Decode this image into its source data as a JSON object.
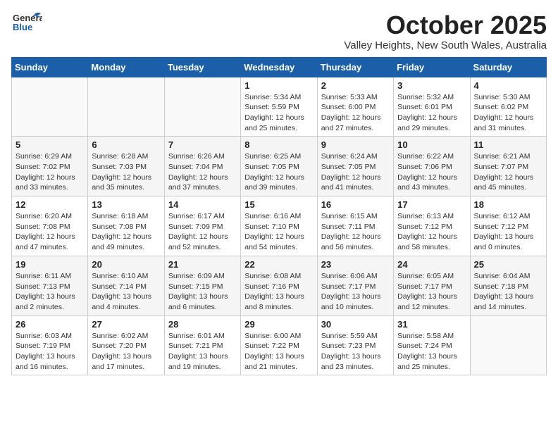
{
  "header": {
    "logo_general": "General",
    "logo_blue": "Blue",
    "title": "October 2025",
    "subtitle": "Valley Heights, New South Wales, Australia"
  },
  "days_of_week": [
    "Sunday",
    "Monday",
    "Tuesday",
    "Wednesday",
    "Thursday",
    "Friday",
    "Saturday"
  ],
  "weeks": [
    [
      {
        "day": "",
        "info": ""
      },
      {
        "day": "",
        "info": ""
      },
      {
        "day": "",
        "info": ""
      },
      {
        "day": "1",
        "info": "Sunrise: 5:34 AM\nSunset: 5:59 PM\nDaylight: 12 hours\nand 25 minutes."
      },
      {
        "day": "2",
        "info": "Sunrise: 5:33 AM\nSunset: 6:00 PM\nDaylight: 12 hours\nand 27 minutes."
      },
      {
        "day": "3",
        "info": "Sunrise: 5:32 AM\nSunset: 6:01 PM\nDaylight: 12 hours\nand 29 minutes."
      },
      {
        "day": "4",
        "info": "Sunrise: 5:30 AM\nSunset: 6:02 PM\nDaylight: 12 hours\nand 31 minutes."
      }
    ],
    [
      {
        "day": "5",
        "info": "Sunrise: 6:29 AM\nSunset: 7:02 PM\nDaylight: 12 hours\nand 33 minutes."
      },
      {
        "day": "6",
        "info": "Sunrise: 6:28 AM\nSunset: 7:03 PM\nDaylight: 12 hours\nand 35 minutes."
      },
      {
        "day": "7",
        "info": "Sunrise: 6:26 AM\nSunset: 7:04 PM\nDaylight: 12 hours\nand 37 minutes."
      },
      {
        "day": "8",
        "info": "Sunrise: 6:25 AM\nSunset: 7:05 PM\nDaylight: 12 hours\nand 39 minutes."
      },
      {
        "day": "9",
        "info": "Sunrise: 6:24 AM\nSunset: 7:05 PM\nDaylight: 12 hours\nand 41 minutes."
      },
      {
        "day": "10",
        "info": "Sunrise: 6:22 AM\nSunset: 7:06 PM\nDaylight: 12 hours\nand 43 minutes."
      },
      {
        "day": "11",
        "info": "Sunrise: 6:21 AM\nSunset: 7:07 PM\nDaylight: 12 hours\nand 45 minutes."
      }
    ],
    [
      {
        "day": "12",
        "info": "Sunrise: 6:20 AM\nSunset: 7:08 PM\nDaylight: 12 hours\nand 47 minutes."
      },
      {
        "day": "13",
        "info": "Sunrise: 6:18 AM\nSunset: 7:08 PM\nDaylight: 12 hours\nand 49 minutes."
      },
      {
        "day": "14",
        "info": "Sunrise: 6:17 AM\nSunset: 7:09 PM\nDaylight: 12 hours\nand 52 minutes."
      },
      {
        "day": "15",
        "info": "Sunrise: 6:16 AM\nSunset: 7:10 PM\nDaylight: 12 hours\nand 54 minutes."
      },
      {
        "day": "16",
        "info": "Sunrise: 6:15 AM\nSunset: 7:11 PM\nDaylight: 12 hours\nand 56 minutes."
      },
      {
        "day": "17",
        "info": "Sunrise: 6:13 AM\nSunset: 7:12 PM\nDaylight: 12 hours\nand 58 minutes."
      },
      {
        "day": "18",
        "info": "Sunrise: 6:12 AM\nSunset: 7:12 PM\nDaylight: 13 hours\nand 0 minutes."
      }
    ],
    [
      {
        "day": "19",
        "info": "Sunrise: 6:11 AM\nSunset: 7:13 PM\nDaylight: 13 hours\nand 2 minutes."
      },
      {
        "day": "20",
        "info": "Sunrise: 6:10 AM\nSunset: 7:14 PM\nDaylight: 13 hours\nand 4 minutes."
      },
      {
        "day": "21",
        "info": "Sunrise: 6:09 AM\nSunset: 7:15 PM\nDaylight: 13 hours\nand 6 minutes."
      },
      {
        "day": "22",
        "info": "Sunrise: 6:08 AM\nSunset: 7:16 PM\nDaylight: 13 hours\nand 8 minutes."
      },
      {
        "day": "23",
        "info": "Sunrise: 6:06 AM\nSunset: 7:17 PM\nDaylight: 13 hours\nand 10 minutes."
      },
      {
        "day": "24",
        "info": "Sunrise: 6:05 AM\nSunset: 7:17 PM\nDaylight: 13 hours\nand 12 minutes."
      },
      {
        "day": "25",
        "info": "Sunrise: 6:04 AM\nSunset: 7:18 PM\nDaylight: 13 hours\nand 14 minutes."
      }
    ],
    [
      {
        "day": "26",
        "info": "Sunrise: 6:03 AM\nSunset: 7:19 PM\nDaylight: 13 hours\nand 16 minutes."
      },
      {
        "day": "27",
        "info": "Sunrise: 6:02 AM\nSunset: 7:20 PM\nDaylight: 13 hours\nand 17 minutes."
      },
      {
        "day": "28",
        "info": "Sunrise: 6:01 AM\nSunset: 7:21 PM\nDaylight: 13 hours\nand 19 minutes."
      },
      {
        "day": "29",
        "info": "Sunrise: 6:00 AM\nSunset: 7:22 PM\nDaylight: 13 hours\nand 21 minutes."
      },
      {
        "day": "30",
        "info": "Sunrise: 5:59 AM\nSunset: 7:23 PM\nDaylight: 13 hours\nand 23 minutes."
      },
      {
        "day": "31",
        "info": "Sunrise: 5:58 AM\nSunset: 7:24 PM\nDaylight: 13 hours\nand 25 minutes."
      },
      {
        "day": "",
        "info": ""
      }
    ]
  ]
}
